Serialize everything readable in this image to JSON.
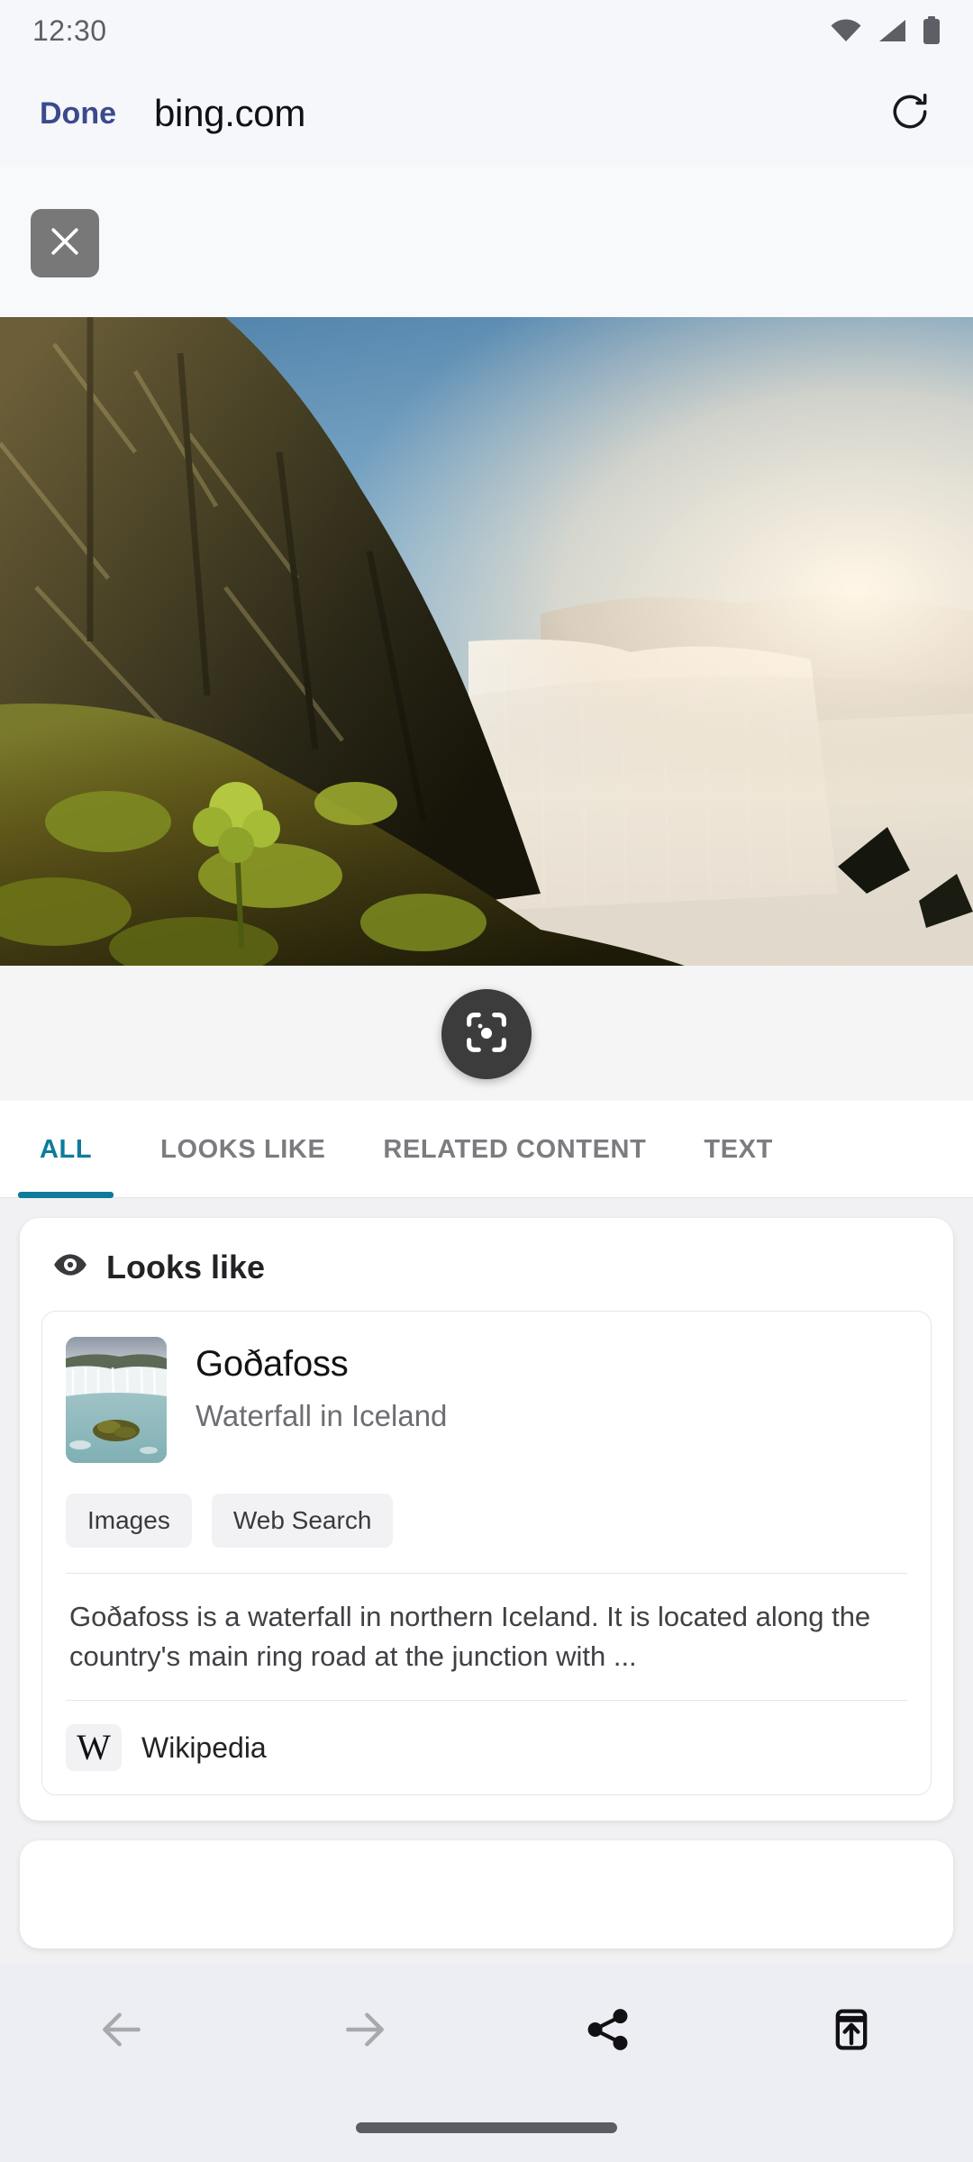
{
  "status_bar": {
    "time": "12:30",
    "icons": [
      "wifi-icon",
      "cellular-signal-icon",
      "battery-icon"
    ]
  },
  "browser_header": {
    "done_label": "Done",
    "site_title": "bing.com",
    "reload_icon": "reload-icon"
  },
  "lens_overlay": {
    "close_icon": "close-icon",
    "hero_image_alt": "Goðafoss waterfall in Iceland with mossy basalt cliff",
    "lens_button_icon": "visual-search-icon"
  },
  "tabs": [
    {
      "label": "ALL",
      "active": true
    },
    {
      "label": "LOOKS LIKE",
      "active": false
    },
    {
      "label": "RELATED CONTENT",
      "active": false
    },
    {
      "label": "TEXT",
      "active": false
    }
  ],
  "sections": [
    {
      "icon": "eye-icon",
      "title": "Looks like",
      "result": {
        "thumbnail_alt": "Goðafoss waterfall thumbnail",
        "name": "Goðafoss",
        "subtitle": "Waterfall in Iceland",
        "chips": [
          "Images",
          "Web Search"
        ],
        "description": "Goðafoss is a waterfall in northern Iceland. It is located along the country's main ring road at the junction with ...",
        "source": {
          "logo": "W",
          "name": "Wikipedia"
        }
      }
    }
  ],
  "bottom_nav": [
    {
      "name": "back-button",
      "icon": "arrow-left-icon",
      "enabled": false
    },
    {
      "name": "forward-button",
      "icon": "arrow-right-icon",
      "enabled": false
    },
    {
      "name": "share-button",
      "icon": "share-icon",
      "enabled": true
    },
    {
      "name": "open-external-button",
      "icon": "open-in-browser-icon",
      "enabled": true
    }
  ],
  "colors": {
    "accent_teal": "#0e7b9c",
    "done_blue": "#3b4a8c",
    "page_bg": "#f1f1f3",
    "chrome_bg": "#f6f7fb",
    "nav_bg": "#eceef3"
  }
}
